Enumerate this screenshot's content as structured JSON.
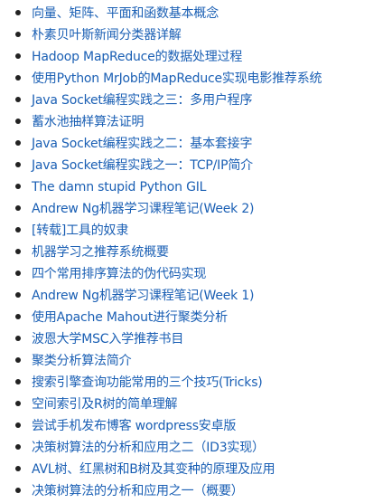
{
  "colors": {
    "link": "#1a5fb4",
    "bullet": "#222222",
    "background": "#ffffff"
  },
  "posts": [
    "向量、矩阵、平面和函数基本概念",
    "朴素贝叶斯新闻分类器详解",
    "Hadoop MapReduce的数据处理过程",
    "使用Python MrJob的MapReduce实现电影推荐系统",
    "Java Socket编程实践之三：多用户程序",
    "蓄水池抽样算法证明",
    "Java Socket编程实践之二：基本套接字",
    "Java Socket编程实践之一：TCP/IP简介",
    "The damn stupid Python GIL",
    "Andrew Ng机器学习课程笔记(Week 2)",
    "[转载]工具的奴隶",
    "机器学习之推荐系统概要",
    "四个常用排序算法的伪代码实现",
    "Andrew Ng机器学习课程笔记(Week 1)",
    "使用Apache Mahout进行聚类分析",
    "波恩大学MSC入学推荐书目",
    "聚类分析算法简介",
    "搜索引擎查询功能常用的三个技巧(Tricks)",
    "空间索引及R树的简单理解",
    "尝试手机发布博客 wordpress安卓版",
    "决策树算法的分析和应用之二（ID3实现）",
    "AVL树、红黑树和B树及其变种的原理及应用",
    "决策树算法的分析和应用之一（概要）"
  ]
}
